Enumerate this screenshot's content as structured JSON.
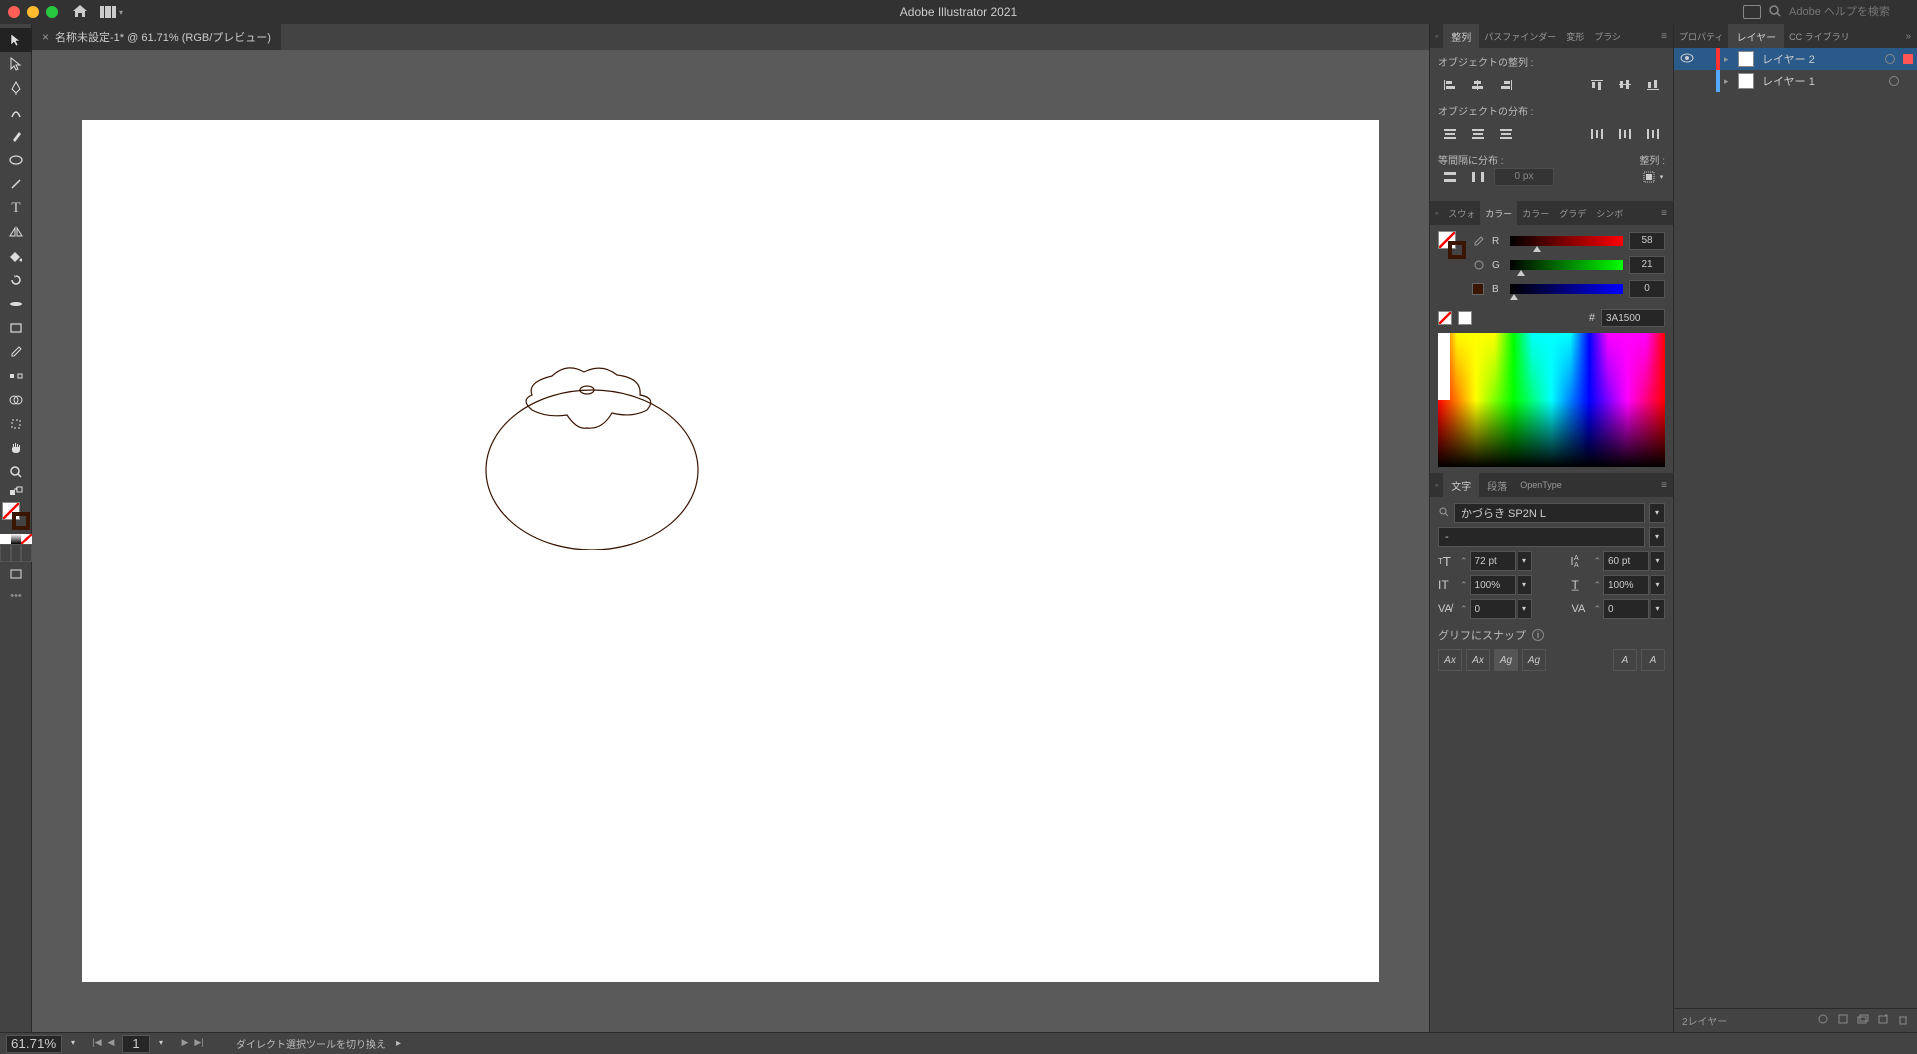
{
  "app": {
    "title": "Adobe Illustrator 2021",
    "search_placeholder": "Adobe ヘルプを検索"
  },
  "document": {
    "tab_title": "名称未設定-1* @ 61.71% (RGB/プレビュー)",
    "zoom": "61.71%",
    "artboard_num": "1"
  },
  "align_panel": {
    "tabs": [
      "整列",
      "パスファインダー",
      "変形",
      "ブラシ"
    ],
    "active_tab": 0,
    "label_align": "オブジェクトの整列 :",
    "label_distribute": "オブジェクトの分布 :",
    "label_spacing": "等間隔に分布 :",
    "label_alignto": "整列 :",
    "spacing_value": "0 px"
  },
  "color_panel": {
    "tabs": [
      "スウォ",
      "カラー",
      "カラー",
      "グラデ",
      "シンボ"
    ],
    "active_tab": 1,
    "r_label": "R",
    "r_value": "58",
    "g_label": "G",
    "g_value": "21",
    "b_label": "B",
    "b_value": "0",
    "hex_label": "#",
    "hex_value": "3A1500"
  },
  "char_panel": {
    "tabs": [
      "文字",
      "段落",
      "OpenType"
    ],
    "active_tab": 0,
    "font_name": "かづらき SP2N L",
    "font_style": "-",
    "font_size": "72 pt",
    "leading": "60 pt",
    "vscale": "100%",
    "hscale": "100%",
    "tracking": "0",
    "baseline": "0",
    "snap_label": "グリフにスナップ"
  },
  "layers_panel": {
    "tabs_left": [
      "プロパティ",
      "レイヤー",
      "CC ライブラリ"
    ],
    "active_tab": 1,
    "layers": [
      {
        "name": "レイヤー 2",
        "selected": true,
        "color": "red"
      },
      {
        "name": "レイヤー 1",
        "selected": false,
        "color": "blue"
      }
    ],
    "footer_count": "2レイヤー"
  },
  "statusbar": {
    "tool_hint": "ダイレクト選択ツールを切り換え"
  }
}
